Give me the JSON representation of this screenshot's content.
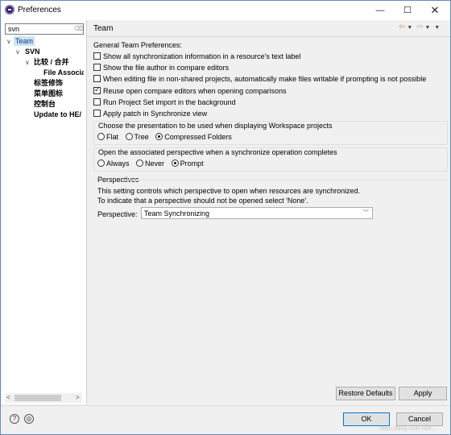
{
  "window": {
    "title": "Preferences",
    "minimize_glyph": "—",
    "maximize_glyph": "☐",
    "close_glyph": "✕"
  },
  "filter": {
    "value": "svn",
    "clear_glyph": "⌫"
  },
  "tree": {
    "team": "Team",
    "svn": "SVN",
    "compare_merge": "比较 / 合并",
    "file_assoc": "File Associa",
    "label_decorations": "标签修饰",
    "menu_icons": "菜单图标",
    "console": "控制台",
    "update_to_head": "Update to HE/",
    "expanded_glyph": "∨"
  },
  "page": {
    "title": "Team",
    "nav_icons": [
      "back-arrow",
      "dropdown",
      "forward-arrow",
      "dropdown",
      "menu"
    ],
    "section_label": "General Team Preferences:",
    "checkboxes": [
      {
        "label": "Show all synchronization information in a resource's text label",
        "checked": false
      },
      {
        "label": "Show the file author in compare editors",
        "checked": false
      },
      {
        "label": "When editing file in non-shared projects, automatically make files writable if prompting is not possible",
        "checked": false
      },
      {
        "label": "Reuse open compare editors when opening comparisons",
        "checked": true
      },
      {
        "label": "Run Project Set import in the background",
        "checked": false
      },
      {
        "label": "Apply patch in Synchronize view",
        "checked": false
      }
    ],
    "presentation": {
      "title": "Choose the presentation to be used when displaying Workspace projects",
      "options": [
        "Flat",
        "Tree",
        "Compressed Folders"
      ],
      "selected": "Compressed Folders"
    },
    "perspective_switch": {
      "title": "Open the associated perspective when a synchronize operation completes",
      "options": [
        "Always",
        "Never",
        "Prompt"
      ],
      "selected": "Prompt"
    },
    "perspectives": {
      "title": "Perspectives",
      "desc_line1": "This setting controls which perspective to open when resources are synchronized.",
      "desc_line2": "To indicate that a perspective should not be opened select 'None'.",
      "field_label": "Perspective:",
      "value": "Team Synchronizing"
    },
    "restore_defaults_label": "Restore Defaults",
    "apply_label": "Apply"
  },
  "footer": {
    "help_glyph": "?",
    "import_export_glyph": "◎",
    "ok_label": "OK",
    "cancel_label": "Cancel",
    "watermark": "https://blog.csdn.net/..."
  },
  "colors": {
    "selection": "#cce4f7",
    "accent": "#0078d7",
    "window_border": "#6a8bb8"
  }
}
